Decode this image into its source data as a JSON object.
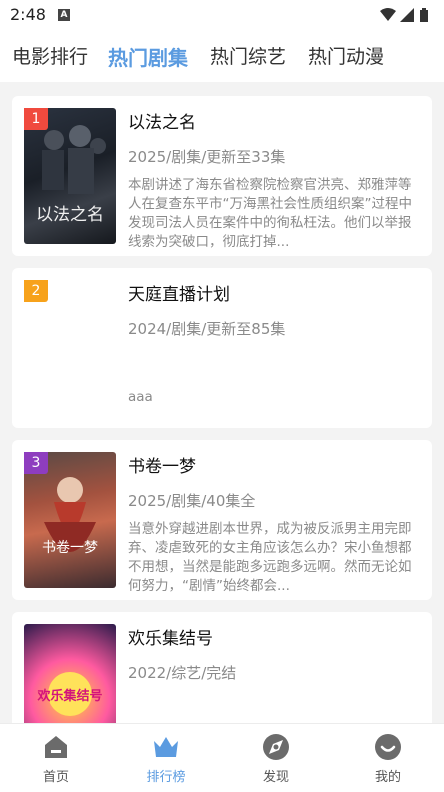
{
  "status_bar": {
    "time": "2:48",
    "notif_icon": "A"
  },
  "tabs": [
    {
      "label": "电影排行",
      "active": false
    },
    {
      "label": "热门剧集",
      "active": true
    },
    {
      "label": "热门综艺",
      "active": false
    },
    {
      "label": "热门动漫",
      "active": false
    }
  ],
  "items": [
    {
      "rank": "1",
      "rank_color": "#f04a3e",
      "title": "以法之名",
      "meta": "2025/剧集/更新至33集",
      "desc": "本剧讲述了海东省检察院检察官洪亮、郑雅萍等人在复查东平市“万海黑社会性质组织案”过程中发现司法人员在案件中的徇私枉法。他们以举报线索为突破口，彻底打掉...",
      "poster_text": "以法之名"
    },
    {
      "rank": "2",
      "rank_color": "#f7a21b",
      "title": "天庭直播计划",
      "meta": "2024/剧集/更新至85集",
      "desc": "aaa",
      "poster_text": ""
    },
    {
      "rank": "3",
      "rank_color": "#8e3dbf",
      "title": "书卷一梦",
      "meta": "2025/剧集/40集全",
      "desc": "当意外穿越进剧本世界，成为被反派男主用完即弃、凌虐致死的女主角应该怎么办？宋小鱼想都不用想，当然是能跑多远跑多远啊。然而无论如何努力，“剧情”始终都会...",
      "poster_text": "书卷一梦"
    },
    {
      "rank": "",
      "rank_color": "",
      "title": "欢乐集结号",
      "meta": "2022/综艺/完结",
      "desc": "",
      "poster_text": "欢乐集结号"
    }
  ],
  "bottom_nav": [
    {
      "label": "首页",
      "icon": "home-icon",
      "active": false
    },
    {
      "label": "排行榜",
      "icon": "crown-icon",
      "active": true
    },
    {
      "label": "发现",
      "icon": "compass-icon",
      "active": false
    },
    {
      "label": "我的",
      "icon": "smile-icon",
      "active": false
    }
  ]
}
